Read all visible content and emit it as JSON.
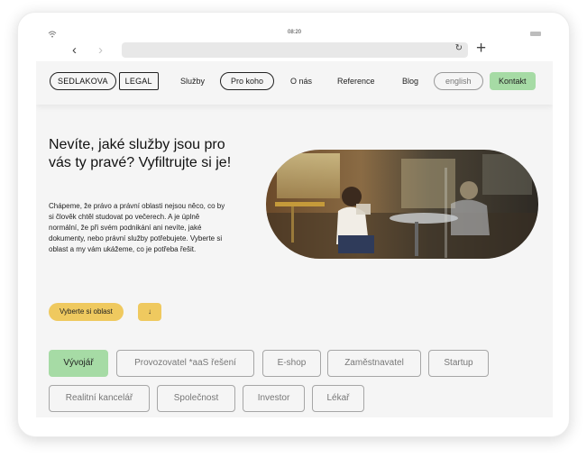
{
  "status": {
    "time": "08:20"
  },
  "browser": {
    "back_label": "‹",
    "forward_label": "›",
    "reload_label": "↻",
    "new_tab_label": "+"
  },
  "logo": {
    "part1": "SEDLAKOVA",
    "part2": "LEGAL"
  },
  "nav": {
    "items": [
      "Služby",
      "Pro koho",
      "O nás",
      "Reference",
      "Blog"
    ],
    "language": "english",
    "contact": "Kontakt"
  },
  "hero": {
    "headline": "Nevíte, jaké služby jsou pro vás ty pravé? Vyfiltrujte si je!",
    "description": "Chápeme, že právo a právní oblasti nejsou něco, co by si člověk chtěl studovat po večerech. A je úplně normální, že při svém podnikání ani nevíte, jaké dokumenty, nebo právní služby potřebujete. Vyberte si oblast a my vám ukážeme, co je potřeba řešit.",
    "select_button": "Vyberte si oblast",
    "arrow_button": "↓"
  },
  "filters": {
    "row1": [
      "Vývojář",
      "Provozovatel *aaS řešení",
      "E-shop",
      "Zaměstnavatel",
      "Startup"
    ],
    "row2": [
      "Realitní kancelář",
      "Společnost",
      "Investor",
      "Lékař"
    ],
    "active": "Vývojář"
  },
  "colors": {
    "accent_green": "#a6dba5",
    "accent_yellow": "#efc95f",
    "background": "#f5f5f5"
  },
  "icons": {
    "wifi": "wifi-icon",
    "battery": "battery-icon",
    "reload": "reload-icon",
    "plus": "plus-icon"
  }
}
